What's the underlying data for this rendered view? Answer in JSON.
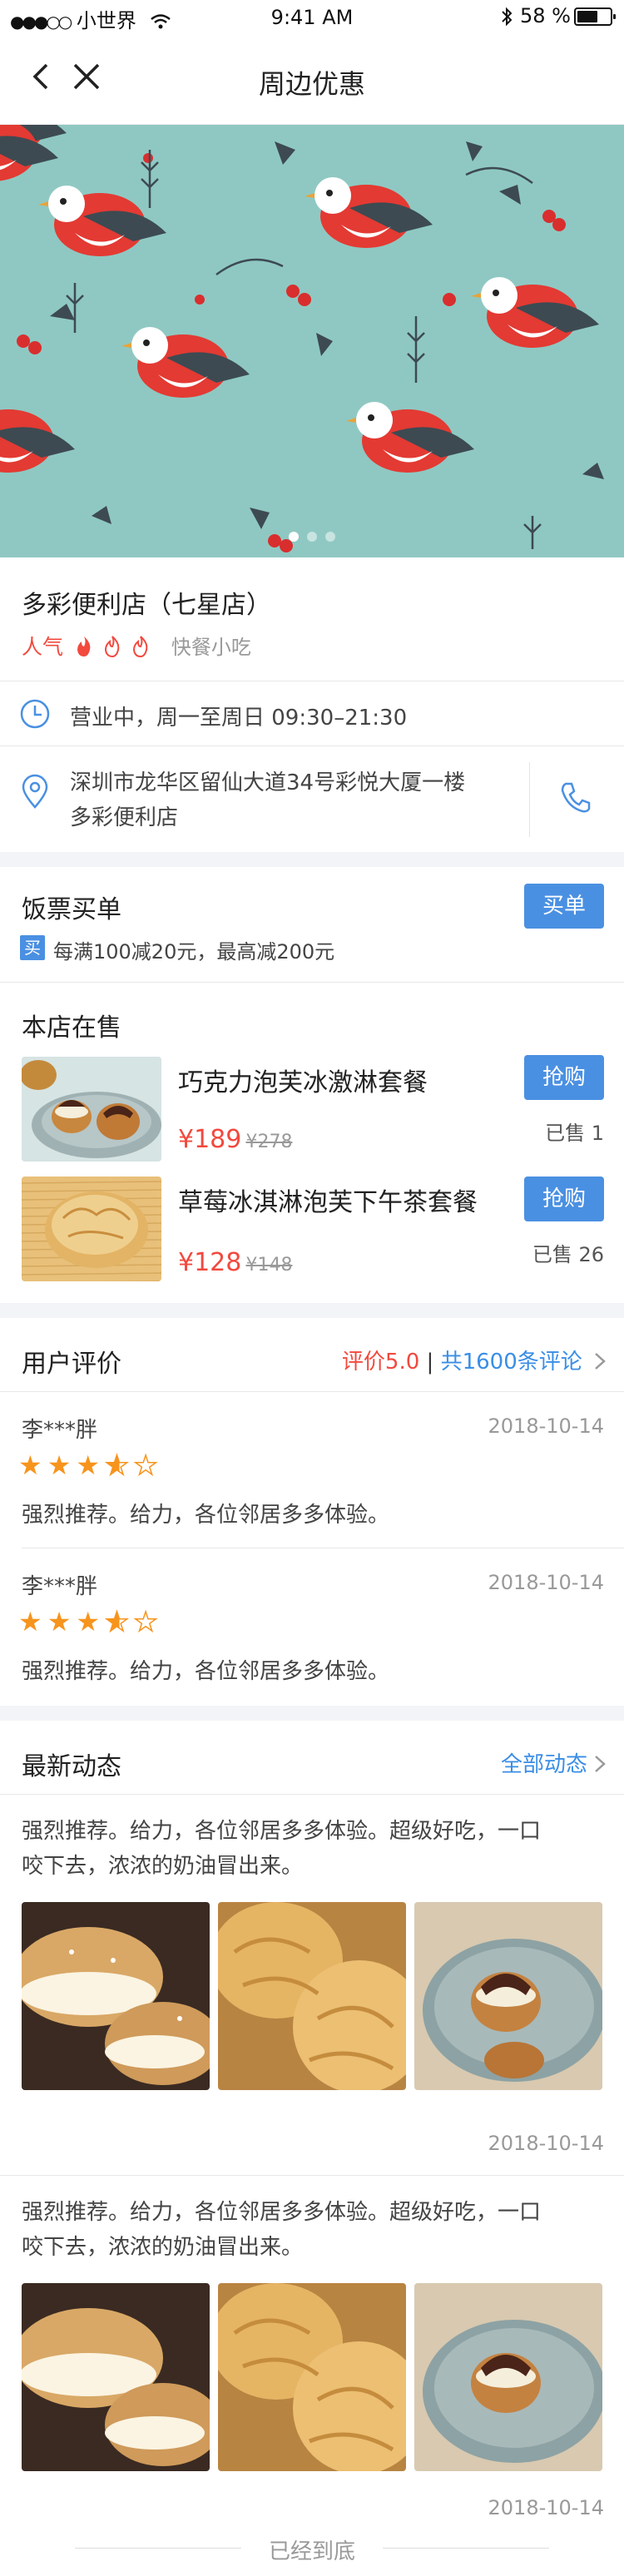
{
  "status_bar": {
    "carrier": "小世界",
    "time": "9:41 AM",
    "battery": "58 %"
  },
  "nav": {
    "title": "周边优惠"
  },
  "store": {
    "name": "多彩便利店（七星店）",
    "popularity_label": "人气",
    "category": "快餐小吃",
    "hours": "营业中，周一至周日 09:30–21:30",
    "address_line1": "深圳市龙华区留仙大道34号彩悦大厦一楼",
    "address_line2": "多彩便利店"
  },
  "voucher": {
    "title": "饭票买单",
    "button": "买单",
    "tag": "买",
    "desc": "每满100减20元，最高减200元"
  },
  "on_sale": {
    "title": "本店在售",
    "items": [
      {
        "name": "巧克力泡芙冰激淋套餐",
        "price": "¥189",
        "orig": "¥278",
        "button": "抢购",
        "sold": "已售 1"
      },
      {
        "name": "草莓冰淇淋泡芙下午茶套餐",
        "price": "¥128",
        "orig": "¥148",
        "button": "抢购",
        "sold": "已售 26"
      }
    ]
  },
  "reviews": {
    "title": "用户评价",
    "score": "评价5.0",
    "sep": "|",
    "count": "共1600条评论",
    "items": [
      {
        "user": "李***胖",
        "date": "2018-10-14",
        "rating": 3.5,
        "text": "强烈推荐。给力，各位邻居多多体验。"
      },
      {
        "user": "李***胖",
        "date": "2018-10-14",
        "rating": 3.5,
        "text": "强烈推荐。给力，各位邻居多多体验。"
      }
    ]
  },
  "news": {
    "title": "最新动态",
    "all": "全部动态",
    "items": [
      {
        "line1": "强烈推荐。给力，各位邻居多多体验。超级好吃，一口",
        "line2": "咬下去，浓浓的奶油冒出来。",
        "date": "2018-10-14"
      },
      {
        "line1": "强烈推荐。给力，各位邻居多多体验。超级好吃，一口",
        "line2": "咬下去，浓浓的奶油冒出来。",
        "date": "2018-10-14"
      }
    ]
  },
  "footer": {
    "end": "已经到底"
  },
  "colors": {
    "accent": "#4a90e2",
    "price": "#f2493e",
    "star": "#f7941d",
    "banner_bg": "#8fc8c2"
  },
  "icons": [
    "back-icon",
    "close-icon",
    "clock-icon",
    "location-icon",
    "phone-icon",
    "flame-icon",
    "star-icon",
    "chevron-right-icon",
    "wifi-icon",
    "bluetooth-icon",
    "battery-icon"
  ]
}
